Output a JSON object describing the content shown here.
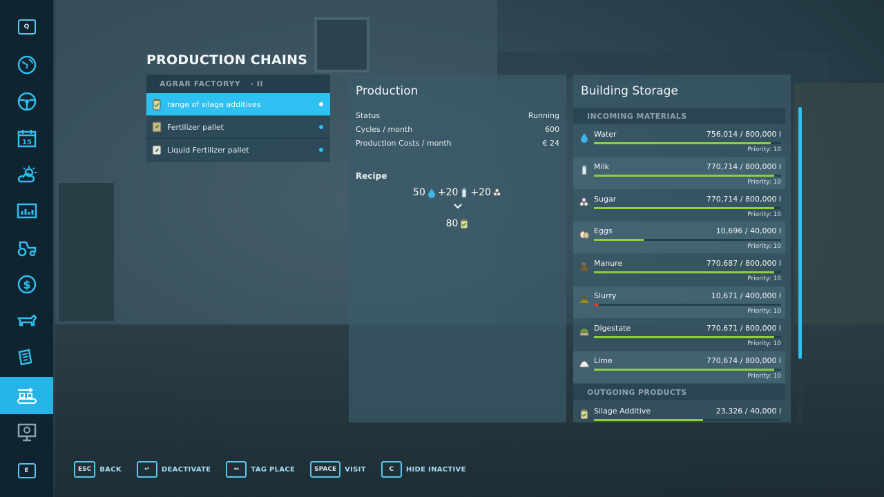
{
  "sidebar": {
    "top_key": "Q",
    "bottom_key": "E",
    "items": [
      {
        "icon": "globe-icon"
      },
      {
        "icon": "steering-wheel-icon"
      },
      {
        "icon": "calendar-icon",
        "label": "15"
      },
      {
        "icon": "weather-icon"
      },
      {
        "icon": "statistics-icon"
      },
      {
        "icon": "tractor-icon"
      },
      {
        "icon": "finances-icon"
      },
      {
        "icon": "animals-icon"
      },
      {
        "icon": "contracts-icon"
      },
      {
        "icon": "production-icon",
        "active": true
      },
      {
        "icon": "help-icon"
      }
    ]
  },
  "page_title": "PRODUCTION CHAINS",
  "chains": {
    "group_name": "AGRAR FACTORYY",
    "group_level": "- II",
    "items": [
      {
        "label": "range of silage additives",
        "icon": "silage-additive-icon",
        "selected": true
      },
      {
        "label": "Fertilizer pallet",
        "icon": "fertilizer-pallet-icon",
        "selected": false
      },
      {
        "label": "Liquid Fertilizer pallet",
        "icon": "liquid-fertilizer-icon",
        "selected": false
      }
    ]
  },
  "production": {
    "title": "Production",
    "status_label": "Status",
    "status_value": "Running",
    "cycles_label": "Cycles / month",
    "cycles_value": "600",
    "costs_label": "Production Costs / month",
    "costs_value": "€ 24",
    "recipe_label": "Recipe",
    "inputs": [
      {
        "amount": "50",
        "icon": "water-icon"
      },
      {
        "amount": "+20",
        "icon": "milk-icon"
      },
      {
        "amount": "+20",
        "icon": "sugar-icon"
      }
    ],
    "output": {
      "amount": "80",
      "icon": "silage-additive-icon"
    }
  },
  "storage": {
    "title": "Building Storage",
    "incoming_header": "INCOMING MATERIALS",
    "outgoing_header": "OUTGOING PRODUCTS",
    "incoming": [
      {
        "name": "Water",
        "value": "756,014",
        "capacity": "/ 800,000 l",
        "fill": 0.945,
        "priority": "Priority: 10",
        "icon": "water-icon"
      },
      {
        "name": "Milk",
        "value": "770,714",
        "capacity": "/ 800,000 l",
        "fill": 0.963,
        "priority": "Priority: 10",
        "icon": "milk-icon"
      },
      {
        "name": "Sugar",
        "value": "770,714",
        "capacity": "/ 800,000 l",
        "fill": 0.963,
        "priority": "Priority: 10",
        "icon": "sugar-icon"
      },
      {
        "name": "Eggs",
        "value": "10,696",
        "capacity": "/ 40,000 l",
        "fill": 0.267,
        "priority": "Priority: 10",
        "icon": "eggs-icon"
      },
      {
        "name": "Manure",
        "value": "770,687",
        "capacity": "/ 800,000 l",
        "fill": 0.963,
        "priority": "Priority: 10",
        "icon": "manure-icon"
      },
      {
        "name": "Slurry",
        "value": "10,671",
        "capacity": "/ 400,000 l",
        "fill": 0.027,
        "priority": "Priority: 10",
        "icon": "slurry-icon",
        "low": true
      },
      {
        "name": "Digestate",
        "value": "770,671",
        "capacity": "/ 800,000 l",
        "fill": 0.963,
        "priority": "Priority: 10",
        "icon": "digestate-icon"
      },
      {
        "name": "Lime",
        "value": "770,674",
        "capacity": "/ 800,000 l",
        "fill": 0.963,
        "priority": "Priority: 10",
        "icon": "lime-icon"
      }
    ],
    "outgoing": [
      {
        "name": "Silage Additive",
        "value": "23,326",
        "capacity": "/ 40,000 l",
        "fill": 0.583,
        "icon": "silage-additive-icon"
      }
    ]
  },
  "bottom_bar": [
    {
      "key": "ESC",
      "label": "BACK"
    },
    {
      "key": "↵",
      "label": "DEACTIVATE"
    },
    {
      "key": "↔",
      "label": "TAG PLACE"
    },
    {
      "key": "SPACE",
      "label": "VISIT"
    },
    {
      "key": "C",
      "label": "HIDE INACTIVE"
    }
  ],
  "colors": {
    "accent": "#2ec0f0",
    "bar_fill": "#8fcf3c",
    "bar_low": "#d63a2b"
  }
}
